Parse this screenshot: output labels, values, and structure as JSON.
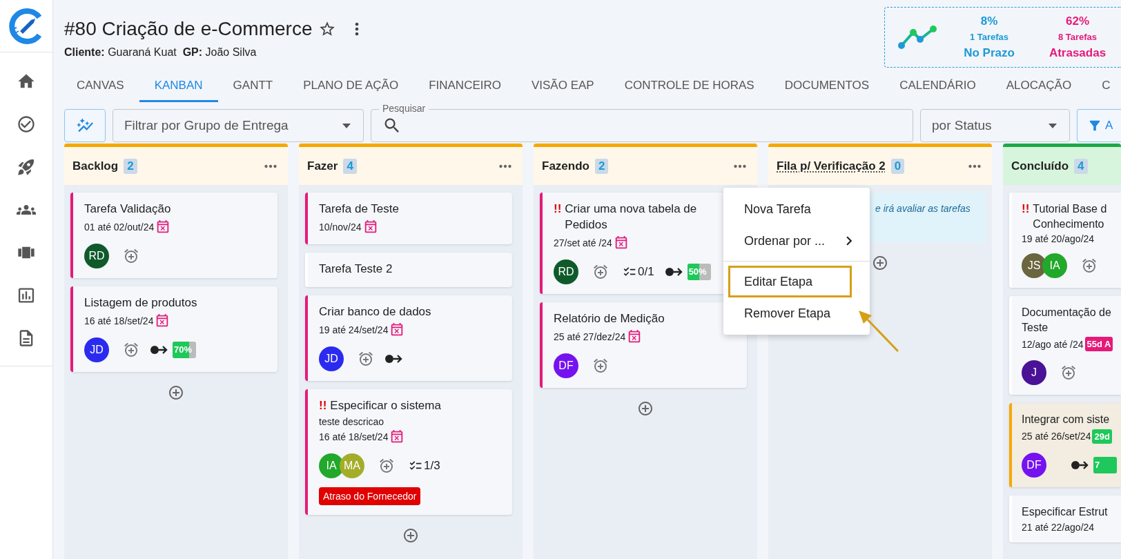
{
  "project": {
    "title": "#80 Criação de e-Commerce",
    "client_label": "Cliente:",
    "client": "Guaraná Kuat",
    "manager_label": "GP:",
    "manager": "João Silva"
  },
  "stats": [
    {
      "percent": "8%",
      "tasks": "1 Tarefas",
      "label": "No Prazo",
      "color": "#1b9ad6"
    },
    {
      "percent": "62%",
      "tasks": "8 Tarefas",
      "label": "Atrasadas",
      "color": "#e6197a"
    }
  ],
  "tabs": [
    {
      "label": "CANVAS",
      "selected": false
    },
    {
      "label": "KANBAN",
      "selected": true
    },
    {
      "label": "GANTT",
      "selected": false
    },
    {
      "label": "PLANO DE AÇÃO",
      "selected": false
    },
    {
      "label": "FINANCEIRO",
      "selected": false
    },
    {
      "label": "VISÃO EAP",
      "selected": false
    },
    {
      "label": "CONTROLE DE HORAS",
      "selected": false
    },
    {
      "label": "DOCUMENTOS",
      "selected": false
    },
    {
      "label": "CALENDÁRIO",
      "selected": false
    },
    {
      "label": "ALOCAÇÃO",
      "selected": false
    },
    {
      "label": "C",
      "selected": false
    }
  ],
  "toolbar": {
    "group_filter": {
      "placeholder": "Filtrar por Grupo de Entrega"
    },
    "search": {
      "label": "Pesquisar"
    },
    "grouping": {
      "value": "por Status"
    },
    "filter_button": "A"
  },
  "columns": [
    {
      "title": "Backlog",
      "count": "2",
      "color": "#f5a800",
      "has_tooltip": false,
      "add_button": true,
      "cards": [
        {
          "title": "Tarefa Validação",
          "color": "#e6197a",
          "highlighted": false,
          "date": "01 até 02/out/24",
          "overdue": true,
          "avatars": [
            {
              "initials": "RD",
              "color": "#0f5a2a"
            }
          ]
        },
        {
          "title": "Listagem de produtos",
          "color": "#e6197a",
          "highlighted": false,
          "date": "16 até 18/set/24",
          "overdue": true,
          "avatars": [
            {
              "initials": "JD",
              "color": "#2b2bf0"
            }
          ],
          "dependency": true,
          "progress": {
            "text": "70%",
            "level": 0.7
          }
        }
      ]
    },
    {
      "title": "Fazer",
      "count": "4",
      "color": "#f5a800",
      "has_tooltip": false,
      "add_button": true,
      "cards": [
        {
          "title": "Tarefa de Teste",
          "color": "#e6197a",
          "highlighted": false,
          "date": "10/nov/24",
          "overdue": true
        },
        {
          "title": "Tarefa Teste 2",
          "color": "#ffffff",
          "highlighted": false
        },
        {
          "title": "Criar banco de dados",
          "color": "#e6197a",
          "highlighted": false,
          "date": "19 até 24/set/24",
          "overdue": true,
          "avatars": [
            {
              "initials": "JD",
              "color": "#2b2bf0"
            }
          ],
          "dependency": true
        },
        {
          "flag": "!!",
          "title": "Especificar o sistema",
          "color": "#e6197a",
          "highlighted": false,
          "description": "teste descricao",
          "date": "16 até 18/set/24",
          "overdue": true,
          "avatars": [
            {
              "initials": "IA",
              "color": "#22a82a"
            },
            {
              "initials": "MA",
              "color": "#a3ad2a"
            }
          ],
          "checklist": "1/3",
          "tag": {
            "text": "Atraso do Fornecedor",
            "color": "#e00000"
          }
        }
      ]
    },
    {
      "title": "Fazendo",
      "count": "2",
      "color": "#f5a800",
      "has_tooltip": false,
      "add_button": true,
      "cards": [
        {
          "flag": "!!",
          "title": "Criar uma nova tabela de\nPedidos",
          "color": "#e6197a",
          "highlighted": false,
          "date": "27/set até /24",
          "overdue": true,
          "avatars": [
            {
              "initials": "RD",
              "color": "#0f5a2a"
            }
          ],
          "checklist": "0/1",
          "dependency": true,
          "progress": {
            "text": "50%",
            "level": 0.5
          }
        },
        {
          "title": "Relatório de Medição",
          "color": "#e6197a",
          "highlighted": false,
          "date": "25 até 27/dez/24",
          "overdue": true,
          "avatars": [
            {
              "initials": "DF",
              "color": "#7512f0"
            }
          ]
        }
      ]
    },
    {
      "title": "Fila p/ Verificação 2",
      "count": "0",
      "color": "#f5a800",
      "has_tooltip": true,
      "add_button": true,
      "note": "e irá avaliar as tarefas"
    },
    {
      "title": "Concluído",
      "count": "4",
      "color": "#1fa848",
      "has_tooltip": false,
      "cards": [
        {
          "flag": "!!",
          "title": "Tutorial Base d\nConhecimento",
          "color": "#ffffff",
          "highlighted": false,
          "date": "19 até 20/ago/24",
          "overdue": false,
          "avatars": [
            {
              "initials": "JS",
              "color": "#6b6540"
            },
            {
              "initials": "IA",
              "color": "#22a82a"
            }
          ]
        },
        {
          "title": "Documentação de\nTeste",
          "color": "#ffffff",
          "highlighted": false,
          "date": "12/ago até /24",
          "overdue": false,
          "badge": {
            "text": "55d A",
            "color": "#e6197a"
          },
          "avatars": [
            {
              "initials": "J",
              "color": "#4a1296"
            }
          ]
        },
        {
          "title": "Integrar com siste",
          "color": "#f5a800",
          "highlighted": true,
          "date": "25 até 26/set/24",
          "overdue": false,
          "badge": {
            "text": "29d",
            "color": "#1fc85a"
          },
          "avatars": [
            {
              "initials": "DF",
              "color": "#7512f0"
            }
          ],
          "dependency": true,
          "progress": {
            "text": "7",
            "level": 1
          }
        },
        {
          "title": "Especificar Estrut",
          "color": "#ffffff",
          "highlighted": false,
          "date": "21 até 22/ago/24",
          "overdue": false
        }
      ]
    }
  ],
  "menu": {
    "items": [
      {
        "label": "Nova Tarefa",
        "submenu": false,
        "annotated": false
      },
      {
        "label": "Ordenar por ...",
        "submenu": true,
        "annotated": false
      },
      {
        "kind": "divider"
      },
      {
        "label": "Editar Etapa",
        "submenu": false,
        "annotated": true
      },
      {
        "label": "Remover Etapa",
        "submenu": false,
        "annotated": false
      }
    ]
  }
}
